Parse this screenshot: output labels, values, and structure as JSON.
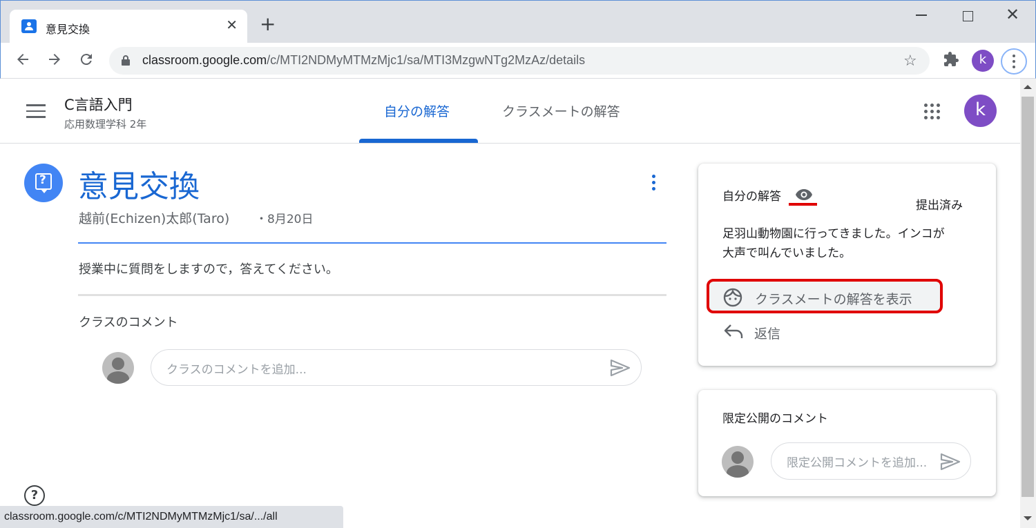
{
  "browser": {
    "tab_title": "意見交換",
    "url_host": "classroom.google.com",
    "url_path": "/c/MTI2NDMyMTMzMjc1/sa/MTI3MzgwNTg2MzAz/details",
    "profile_initial": "k",
    "status_url": "classroom.google.com/c/MTI2NDMyMTMzMjc1/sa/.../all"
  },
  "header": {
    "class_name": "C言語入門",
    "class_section": "応用数理学科 2年",
    "tabs": [
      "自分の解答",
      "クラスメートの解答"
    ],
    "profile_initial": "k"
  },
  "assignment": {
    "title": "意見交換",
    "author": "越前(Echizen)太郎(Taro)",
    "date": "・8月20日",
    "instructions": "授業中に質問をしますので，答えてください。",
    "class_comments_label": "クラスのコメント",
    "class_comment_placeholder": "クラスのコメントを追加..."
  },
  "answer_card": {
    "label": "自分の解答",
    "status": "提出済み",
    "answer_line1": "足羽山動物園に行ってきました。インコが",
    "answer_line2": "大声で叫んでいました。",
    "view_classmates_button": "クラスメートの解答を表示",
    "reply_button": "返信"
  },
  "private_card": {
    "label": "限定公開のコメント",
    "placeholder": "限定公開コメントを追加..."
  },
  "colors": {
    "accent": "#1967d2",
    "highlight": "#e00000",
    "avatar": "#7e4dc5"
  }
}
